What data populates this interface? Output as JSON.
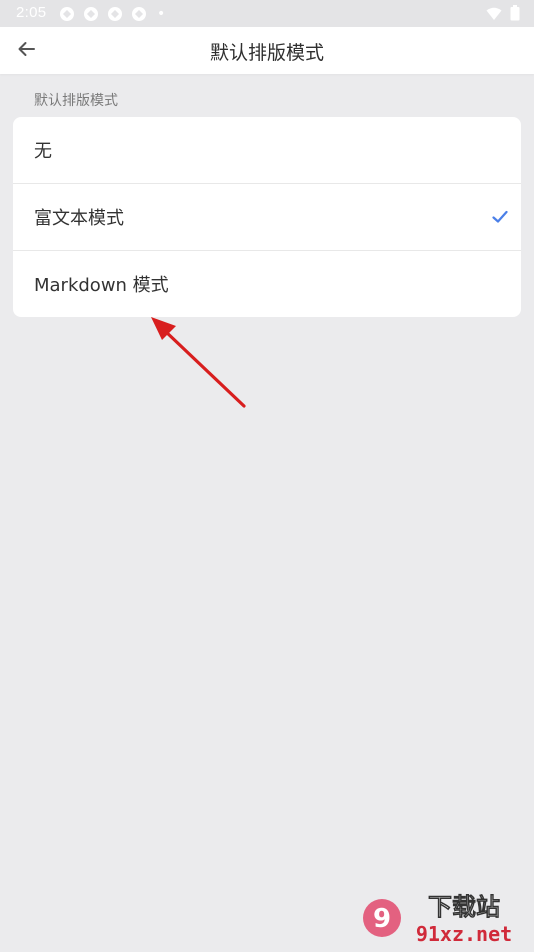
{
  "status_bar": {
    "time": "2:05",
    "notification_icons": [
      "sync-icon",
      "sync-icon",
      "sync-icon",
      "sync-icon"
    ],
    "dot": "•",
    "right_icons": [
      "wifi-icon",
      "battery-icon"
    ]
  },
  "app_bar": {
    "back_icon": "arrow-left-icon",
    "title": "默认排版模式"
  },
  "section": {
    "label": "默认排版模式",
    "options": [
      {
        "label": "无",
        "selected": false
      },
      {
        "label": "富文本模式",
        "selected": true
      },
      {
        "label": "Markdown 模式",
        "selected": false
      }
    ]
  },
  "colors": {
    "accent": "#4a7fe8",
    "annotation": "#d81e1e",
    "background": "#ebebed",
    "card": "#ffffff"
  },
  "watermark": {
    "logo_text": "9",
    "brand_top": "下载站",
    "brand_bottom": "91xz.net"
  }
}
